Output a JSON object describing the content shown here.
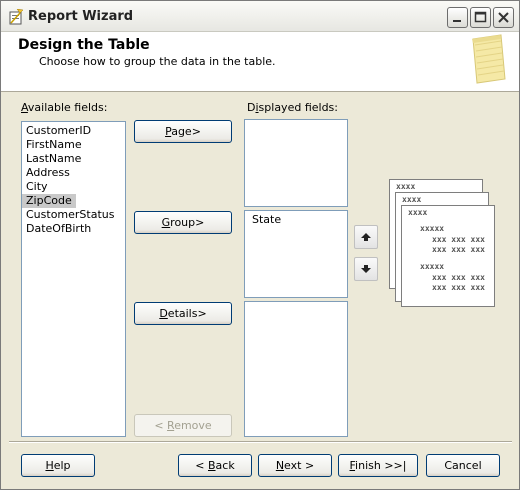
{
  "window": {
    "title": "Report Wizard"
  },
  "header": {
    "title": "Design the Table",
    "subtitle": "Choose how to group the data in the table."
  },
  "available_fields": {
    "label_key": "A",
    "label_rest": "vailable fields:",
    "items": [
      "CustomerID",
      "FirstName",
      "LastName",
      "Address",
      "City",
      "ZipCode",
      "CustomerStatus",
      "DateOfBirth"
    ],
    "selected": "ZipCode"
  },
  "displayed_fields": {
    "label_pre": "D",
    "label_key": "i",
    "label_rest": "splayed fields:",
    "page_items": [],
    "group_items": [
      "State"
    ],
    "details_items": []
  },
  "buttons": {
    "page": {
      "key": "P",
      "rest": "age>"
    },
    "group": {
      "key": "G",
      "rest": "roup>"
    },
    "details": {
      "key": "D",
      "rest": "etails>"
    },
    "remove": {
      "pre": "< ",
      "key": "R",
      "rest": "emove"
    },
    "help": {
      "key": "H",
      "rest": "elp"
    },
    "back": {
      "pre": "< ",
      "key": "B",
      "rest": "ack"
    },
    "next": {
      "key": "N",
      "rest": "ext >"
    },
    "finish": {
      "key": "F",
      "rest": "inish >>|"
    },
    "cancel": "Cancel"
  },
  "preview": {
    "line_a": "xxxx",
    "line_b": "xxxx",
    "line_c": "xxxx",
    "detail_1": "xxxxx",
    "detail_2": "xxx xxx xxx",
    "detail_3": "xxx xxx xxx",
    "detail_4": "xxxxx",
    "detail_5": "xxx xxx xxx",
    "detail_6": "xxx xxx xxx"
  }
}
